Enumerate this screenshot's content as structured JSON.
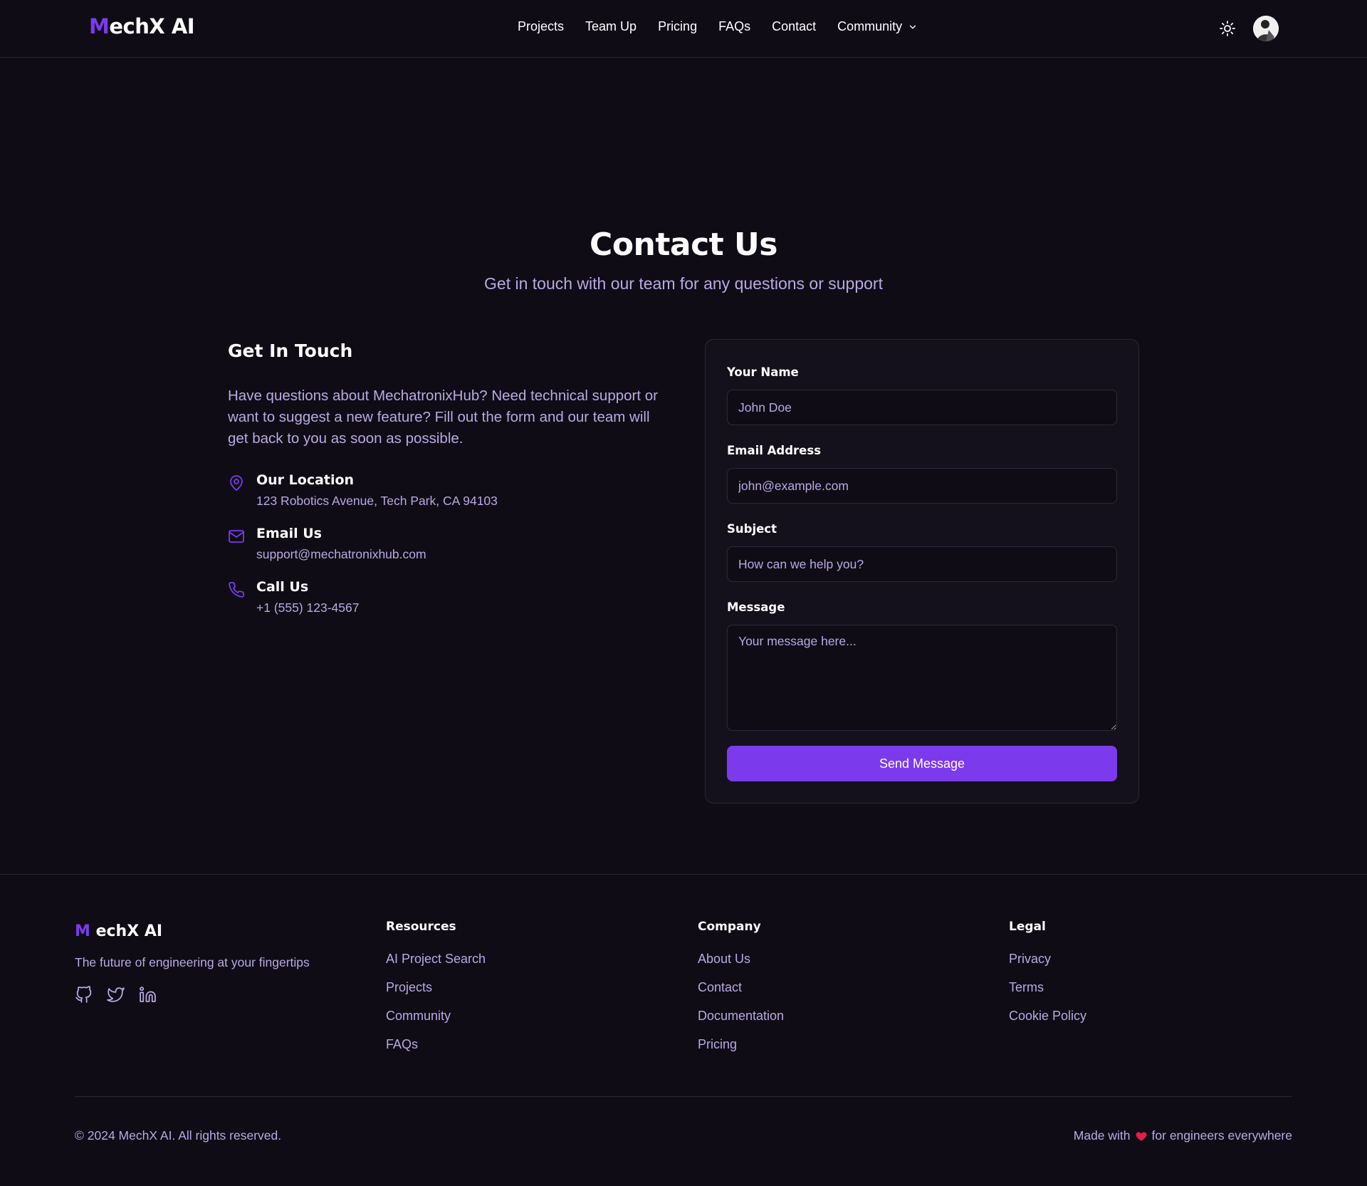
{
  "nav": {
    "logo_m": "M",
    "logo_rest": "echX AI",
    "links": [
      "Projects",
      "Team Up",
      "Pricing",
      "FAQs",
      "Contact"
    ],
    "community_label": "Community",
    "theme_icon": "sun-icon",
    "avatar_icon": "user-avatar"
  },
  "hero": {
    "title": "Contact Us",
    "subtitle": "Get in touch with our team for any questions or support"
  },
  "get_in_touch": {
    "title": "Get In Touch",
    "description": "Have questions about MechatronixHub? Need technical support or want to suggest a new feature? Fill out the form and our team will get back to you as soon as possible.",
    "items": [
      {
        "icon": "map-pin-icon",
        "title": "Our Location",
        "value": "123 Robotics Avenue, Tech Park, CA 94103"
      },
      {
        "icon": "mail-icon",
        "title": "Email Us",
        "value": "support@mechatronixhub.com"
      },
      {
        "icon": "phone-icon",
        "title": "Call Us",
        "value": "+1 (555) 123-4567"
      }
    ]
  },
  "form": {
    "name_label": "Your Name",
    "name_placeholder": "John Doe",
    "email_label": "Email Address",
    "email_placeholder": "john@example.com",
    "subject_label": "Subject",
    "subject_placeholder": "How can we help you?",
    "message_label": "Message",
    "message_placeholder": "Your message here...",
    "submit_label": "Send Message"
  },
  "footer": {
    "logo_m": "M",
    "logo_rest": "echX AI",
    "tagline": "The future of engineering at your fingertips",
    "socials": [
      "github-icon",
      "twitter-icon",
      "linkedin-icon"
    ],
    "columns": [
      {
        "title": "Resources",
        "links": [
          "AI Project Search",
          "Projects",
          "Community",
          "FAQs"
        ]
      },
      {
        "title": "Company",
        "links": [
          "About Us",
          "Contact",
          "Documentation",
          "Pricing"
        ]
      },
      {
        "title": "Legal",
        "links": [
          "Privacy",
          "Terms",
          "Cookie Policy"
        ]
      }
    ],
    "copyright": "© 2024 MechX AI. All rights reserved.",
    "made_with_prefix": "Made with",
    "made_with_suffix": "for engineers everywhere"
  },
  "colors": {
    "background": "#0f0c16",
    "accent": "#7c3aed",
    "muted_text": "#b9a9e3",
    "heart": "#e11d48"
  }
}
